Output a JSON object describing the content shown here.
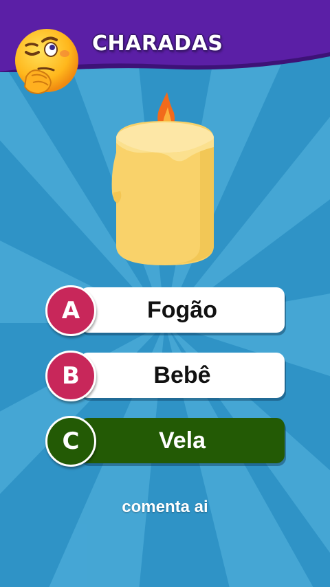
{
  "header": {
    "title": "CHARADAS",
    "icon": "thinking-winking-face-icon"
  },
  "image": {
    "icon": "candle-icon"
  },
  "options": [
    {
      "letter": "A",
      "text": "Fogão",
      "correct": false
    },
    {
      "letter": "B",
      "text": "Bebê",
      "correct": false
    },
    {
      "letter": "C",
      "text": "Vela",
      "correct": true
    }
  ],
  "footer": {
    "caption": "comenta ai"
  },
  "colors": {
    "background": "#2f93c6",
    "header": "#5b1fa6",
    "badge": "#c8275a",
    "correct": "#235a05",
    "candle": "#f9d26a"
  }
}
